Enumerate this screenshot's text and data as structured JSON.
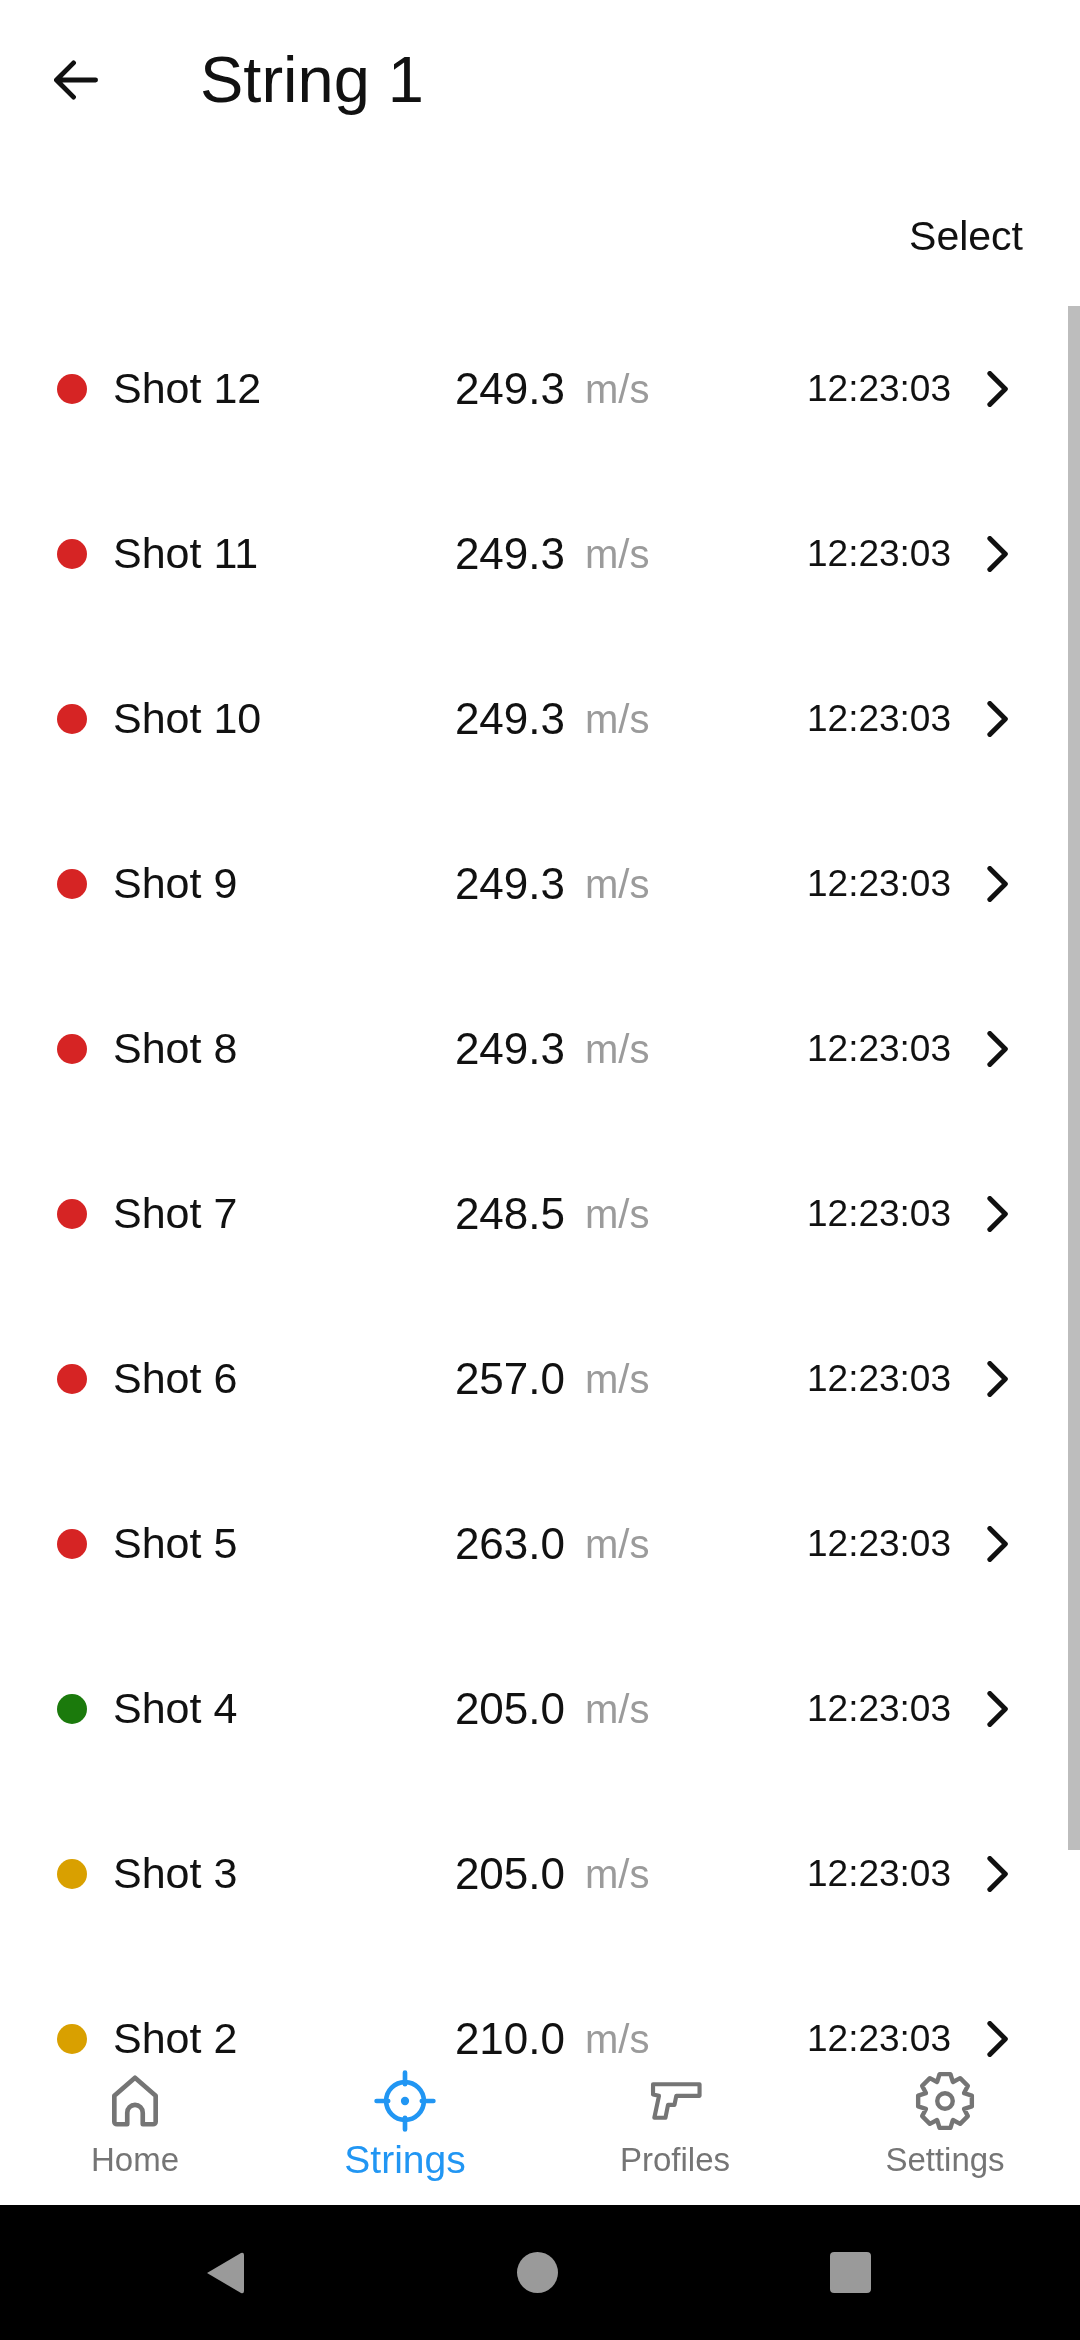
{
  "header": {
    "title": "String 1",
    "action": "Select"
  },
  "shots": [
    {
      "name": "Shot 12",
      "speed": "249.3",
      "unit": "m/s",
      "time": "12:23:03",
      "color": "#d62424"
    },
    {
      "name": "Shot 11",
      "speed": "249.3",
      "unit": "m/s",
      "time": "12:23:03",
      "color": "#d62424"
    },
    {
      "name": "Shot 10",
      "speed": "249.3",
      "unit": "m/s",
      "time": "12:23:03",
      "color": "#d62424"
    },
    {
      "name": "Shot 9",
      "speed": "249.3",
      "unit": "m/s",
      "time": "12:23:03",
      "color": "#d62424"
    },
    {
      "name": "Shot 8",
      "speed": "249.3",
      "unit": "m/s",
      "time": "12:23:03",
      "color": "#d62424"
    },
    {
      "name": "Shot 7",
      "speed": "248.5",
      "unit": "m/s",
      "time": "12:23:03",
      "color": "#d62424"
    },
    {
      "name": "Shot 6",
      "speed": "257.0",
      "unit": "m/s",
      "time": "12:23:03",
      "color": "#d62424"
    },
    {
      "name": "Shot 5",
      "speed": "263.0",
      "unit": "m/s",
      "time": "12:23:03",
      "color": "#d62424"
    },
    {
      "name": "Shot 4",
      "speed": "205.0",
      "unit": "m/s",
      "time": "12:23:03",
      "color": "#1b7a0c"
    },
    {
      "name": "Shot 3",
      "speed": "205.0",
      "unit": "m/s",
      "time": "12:23:03",
      "color": "#d9a000"
    },
    {
      "name": "Shot 2",
      "speed": "210.0",
      "unit": "m/s",
      "time": "12:23:03",
      "color": "#d9a000"
    }
  ],
  "nav": [
    {
      "label": "Home",
      "selected": false
    },
    {
      "label": "Strings",
      "selected": true
    },
    {
      "label": "Profiles",
      "selected": false
    },
    {
      "label": "Settings",
      "selected": false
    }
  ]
}
